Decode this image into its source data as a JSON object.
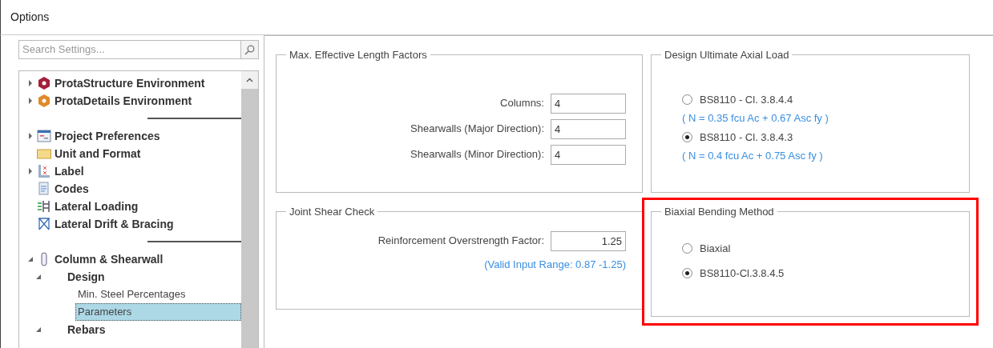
{
  "window": {
    "title": "Options"
  },
  "search": {
    "placeholder": "Search Settings..."
  },
  "tree": [
    {
      "kind": "item",
      "label": "ProtaStructure Environment",
      "expanded": false
    },
    {
      "kind": "item",
      "label": "ProtaDetails Environment",
      "expanded": false
    },
    {
      "kind": "separator"
    },
    {
      "kind": "item",
      "label": "Project Preferences",
      "expanded": false
    },
    {
      "kind": "item",
      "label": "Unit and Format"
    },
    {
      "kind": "item",
      "label": "Label",
      "expanded": false
    },
    {
      "kind": "item",
      "label": "Codes"
    },
    {
      "kind": "item",
      "label": "Lateral Loading"
    },
    {
      "kind": "item",
      "label": "Lateral Drift & Bracing"
    },
    {
      "kind": "separator"
    },
    {
      "kind": "item",
      "label": "Column & Shearwall",
      "expanded": true,
      "children": [
        {
          "kind": "item",
          "label": "Design",
          "expanded": true,
          "children": [
            {
              "kind": "item",
              "label": "Min. Steel Percentages",
              "selected": false
            },
            {
              "kind": "item",
              "label": "Parameters",
              "selected": true
            }
          ]
        },
        {
          "kind": "item",
          "label": "Rebars",
          "expanded": true
        }
      ]
    }
  ],
  "groups": [
    {
      "kind": "fields",
      "title": "Max. Effective Length Factors",
      "fields": [
        {
          "label": "Columns:",
          "value": "4"
        },
        {
          "label": "Shearwalls (Major Direction):",
          "value": "4"
        },
        {
          "label": "Shearwalls (Minor Direction):",
          "value": "4"
        }
      ]
    },
    {
      "kind": "radios",
      "title": "Design Ultimate Axial Load",
      "highlighted": false,
      "options": [
        {
          "label": "BS8110 - Cl. 3.8.4.4",
          "note": "( N  = 0.35 fcu Ac + 0.67 Asc fy )",
          "selected": false
        },
        {
          "label": "BS8110 - Cl. 3.8.4.3",
          "note": "( N  = 0.4 fcu Ac + 0.75 Asc fy )",
          "selected": true
        }
      ]
    },
    {
      "kind": "fields",
      "title": "Joint Shear Check",
      "fields": [
        {
          "label": "Reinforcement Overstrength Factor:",
          "value": "1.25",
          "hint": "(Valid Input Range: 0.87 -1.25)"
        }
      ]
    },
    {
      "kind": "radios",
      "title": "Biaxial Bending Method",
      "highlighted": true,
      "options": [
        {
          "label": "Biaxial",
          "selected": false
        },
        {
          "label": "BS8110-Cl.3.8.4.5",
          "selected": true
        }
      ]
    }
  ]
}
